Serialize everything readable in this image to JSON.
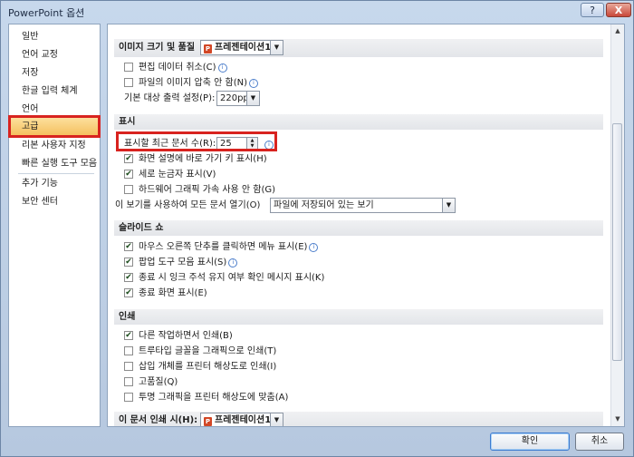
{
  "window": {
    "title": "PowerPoint 옵션",
    "help": "?",
    "close": "X"
  },
  "sidebar": {
    "items": [
      {
        "label": "일반"
      },
      {
        "label": "언어 교정"
      },
      {
        "label": "저장"
      },
      {
        "label": "한글 입력 체계"
      },
      {
        "label": "언어"
      },
      {
        "label": "고급"
      },
      {
        "label": "리본 사용자 지정"
      },
      {
        "label": "빠른 실행 도구 모음"
      },
      {
        "label": "추가 기능"
      },
      {
        "label": "보안 센터"
      }
    ],
    "selected": "고급"
  },
  "image_size": {
    "header": "이미지 크기 및 품질",
    "selector": "프레젠테이션1",
    "discard_edit": "편집 데이터 취소(C)",
    "no_compress": "파일의 이미지 압축 안 함(N)",
    "output_label": "기본 대상 출력 설정(P):",
    "output_value": "220ppi"
  },
  "display": {
    "header": "표시",
    "recent_label": "표시할 최근 문서 수(R):",
    "recent_value": "25",
    "shortcut_keys": "화면 설명에 바로 가기 키 표시(H)",
    "vertical_ruler": "세로 눈금자 표시(V)",
    "hw_accel": "하드웨어 그래픽 가속 사용 안 함(G)",
    "open_view_label": "이 보기를 사용하여 모든 문서 열기(O)",
    "open_view_value": "파일에 저장되어 있는 보기"
  },
  "slideshow": {
    "header": "슬라이드 쇼",
    "right_click_menu": "마우스 오른쪽 단추를 클릭하면 메뉴 표시(E)",
    "popup_toolbar": "팝업 도구 모음 표시(S)",
    "ink_prompt": "종료 시 잉크 주석 유지 여부 확인 메시지 표시(K)",
    "end_slide": "종료 화면 표시(E)"
  },
  "print": {
    "header": "인쇄",
    "background": "다른 작업하면서 인쇄(B)",
    "truetype": "트루타입 글꼴을 그래픽으로 인쇄(T)",
    "inserted_objects": "삽입 개체를 프린터 해상도로 인쇄(I)",
    "high_quality": "고품질(Q)",
    "transparent": "투명 그래픽을 프린터 해상도에 맞춤(A)"
  },
  "print_doc": {
    "label": "이 문서 인쇄 시(H):",
    "selector": "프레젠테이션1"
  },
  "footer": {
    "ok": "확인",
    "cancel": "취소"
  },
  "colors": {
    "highlight": "#d8231f",
    "selected_bg": "#f5c66a"
  }
}
